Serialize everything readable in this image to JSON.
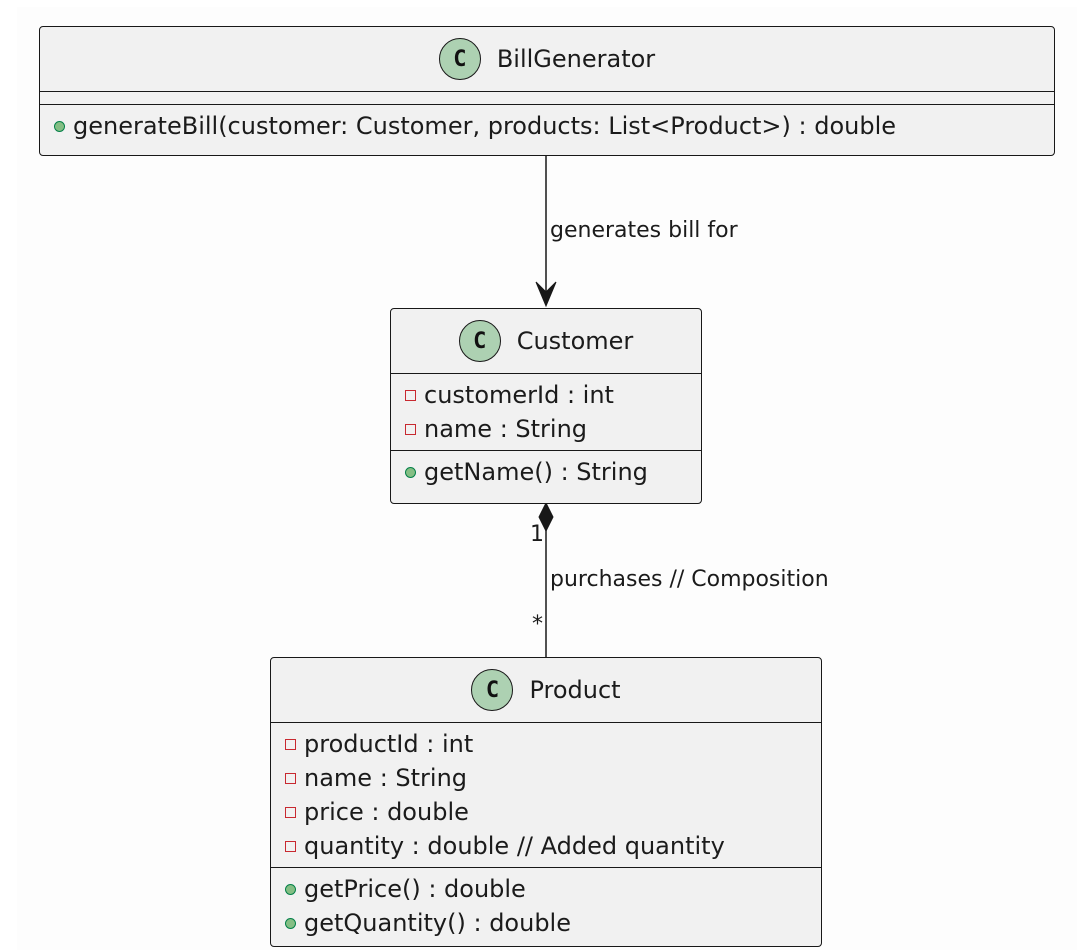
{
  "classes": {
    "bill_generator": {
      "icon_letter": "C",
      "name": "BillGenerator",
      "attributes": [],
      "methods": [
        {
          "visibility": "public",
          "text": "generateBill(customer: Customer, products: List<Product>) : double"
        }
      ]
    },
    "customer": {
      "icon_letter": "C",
      "name": "Customer",
      "attributes": [
        {
          "visibility": "private",
          "text": "customerId : int"
        },
        {
          "visibility": "private",
          "text": "name : String"
        }
      ],
      "methods": [
        {
          "visibility": "public",
          "text": "getName() : String"
        }
      ]
    },
    "product": {
      "icon_letter": "C",
      "name": "Product",
      "attributes": [
        {
          "visibility": "private",
          "text": "productId : int"
        },
        {
          "visibility": "private",
          "text": "name : String"
        },
        {
          "visibility": "private",
          "text": "price : double"
        },
        {
          "visibility": "private",
          "text": "quantity : double  // Added quantity"
        }
      ],
      "methods": [
        {
          "visibility": "public",
          "text": "getPrice() : double"
        },
        {
          "visibility": "public",
          "text": "getQuantity() : double"
        }
      ]
    }
  },
  "relations": {
    "generates": {
      "label": "generates bill for"
    },
    "composition": {
      "label": "purchases  // Composition",
      "source_multiplicity": "1",
      "target_multiplicity": "*"
    }
  },
  "colors": {
    "class_fill": "#f1f1f1",
    "class_icon": "#add1b2",
    "public_marker": "#84be84",
    "private_marker": "#c82930",
    "line": "#181818"
  }
}
